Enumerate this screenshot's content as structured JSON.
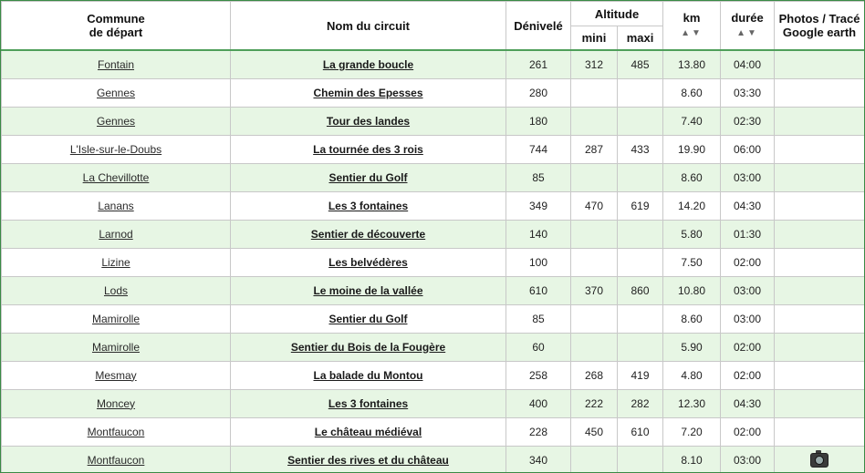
{
  "header": {
    "commune_line1": "Commune",
    "commune_line2": "de départ",
    "circuit": "Nom du circuit",
    "denivele": "Dénivelé",
    "altitude": "Altitude",
    "mini": "mini",
    "maxi": "maxi",
    "km": "km",
    "km_sort": "▲▼",
    "duree": "durée",
    "duree_sort": "▲▼",
    "photos_line1": "Photos / Tracé",
    "photos_line2": "Google earth"
  },
  "rows": [
    {
      "commune": "Fontain",
      "circuit": "La grande boucle",
      "denivele": "261",
      "mini": "312",
      "maxi": "485",
      "km": "13.80",
      "duree": "04:00",
      "photo": false
    },
    {
      "commune": "Gennes",
      "circuit": "Chemin des Epesses",
      "denivele": "280",
      "mini": "",
      "maxi": "",
      "km": "8.60",
      "duree": "03:30",
      "photo": false
    },
    {
      "commune": "Gennes",
      "circuit": "Tour des landes",
      "denivele": "180",
      "mini": "",
      "maxi": "",
      "km": "7.40",
      "duree": "02:30",
      "photo": false
    },
    {
      "commune": "L'Isle-sur-le-Doubs",
      "circuit": "La tournée des 3 rois",
      "denivele": "744",
      "mini": "287",
      "maxi": "433",
      "km": "19.90",
      "duree": "06:00",
      "photo": false
    },
    {
      "commune": "La Chevillotte",
      "circuit": "Sentier du Golf",
      "denivele": "85",
      "mini": "",
      "maxi": "",
      "km": "8.60",
      "duree": "03:00",
      "photo": false
    },
    {
      "commune": "Lanans",
      "circuit": "Les 3 fontaines",
      "denivele": "349",
      "mini": "470",
      "maxi": "619",
      "km": "14.20",
      "duree": "04:30",
      "photo": false
    },
    {
      "commune": "Larnod",
      "circuit": "Sentier de découverte",
      "denivele": "140",
      "mini": "",
      "maxi": "",
      "km": "5.80",
      "duree": "01:30",
      "photo": false
    },
    {
      "commune": "Lizine",
      "circuit": "Les belvédères",
      "denivele": "100",
      "mini": "",
      "maxi": "",
      "km": "7.50",
      "duree": "02:00",
      "photo": false
    },
    {
      "commune": "Lods",
      "circuit": "Le moine de la vallée",
      "denivele": "610",
      "mini": "370",
      "maxi": "860",
      "km": "10.80",
      "duree": "03:00",
      "photo": false
    },
    {
      "commune": "Mamirolle",
      "circuit": "Sentier du Golf",
      "denivele": "85",
      "mini": "",
      "maxi": "",
      "km": "8.60",
      "duree": "03:00",
      "photo": false
    },
    {
      "commune": "Mamirolle",
      "circuit": "Sentier du Bois de la Fougère",
      "denivele": "60",
      "mini": "",
      "maxi": "",
      "km": "5.90",
      "duree": "02:00",
      "photo": false
    },
    {
      "commune": "Mesmay",
      "circuit": "La balade du Montou",
      "denivele": "258",
      "mini": "268",
      "maxi": "419",
      "km": "4.80",
      "duree": "02:00",
      "photo": false
    },
    {
      "commune": "Moncey",
      "circuit": "Les 3 fontaines",
      "denivele": "400",
      "mini": "222",
      "maxi": "282",
      "km": "12.30",
      "duree": "04:30",
      "photo": false
    },
    {
      "commune": "Montfaucon",
      "circuit": "Le château médiéval",
      "denivele": "228",
      "mini": "450",
      "maxi": "610",
      "km": "7.20",
      "duree": "02:00",
      "photo": false
    },
    {
      "commune": "Montfaucon",
      "circuit": "Sentier des rives et du château",
      "denivele": "340",
      "mini": "",
      "maxi": "",
      "km": "8.10",
      "duree": "03:00",
      "photo": true,
      "photo_icon": "camera-icon"
    }
  ]
}
